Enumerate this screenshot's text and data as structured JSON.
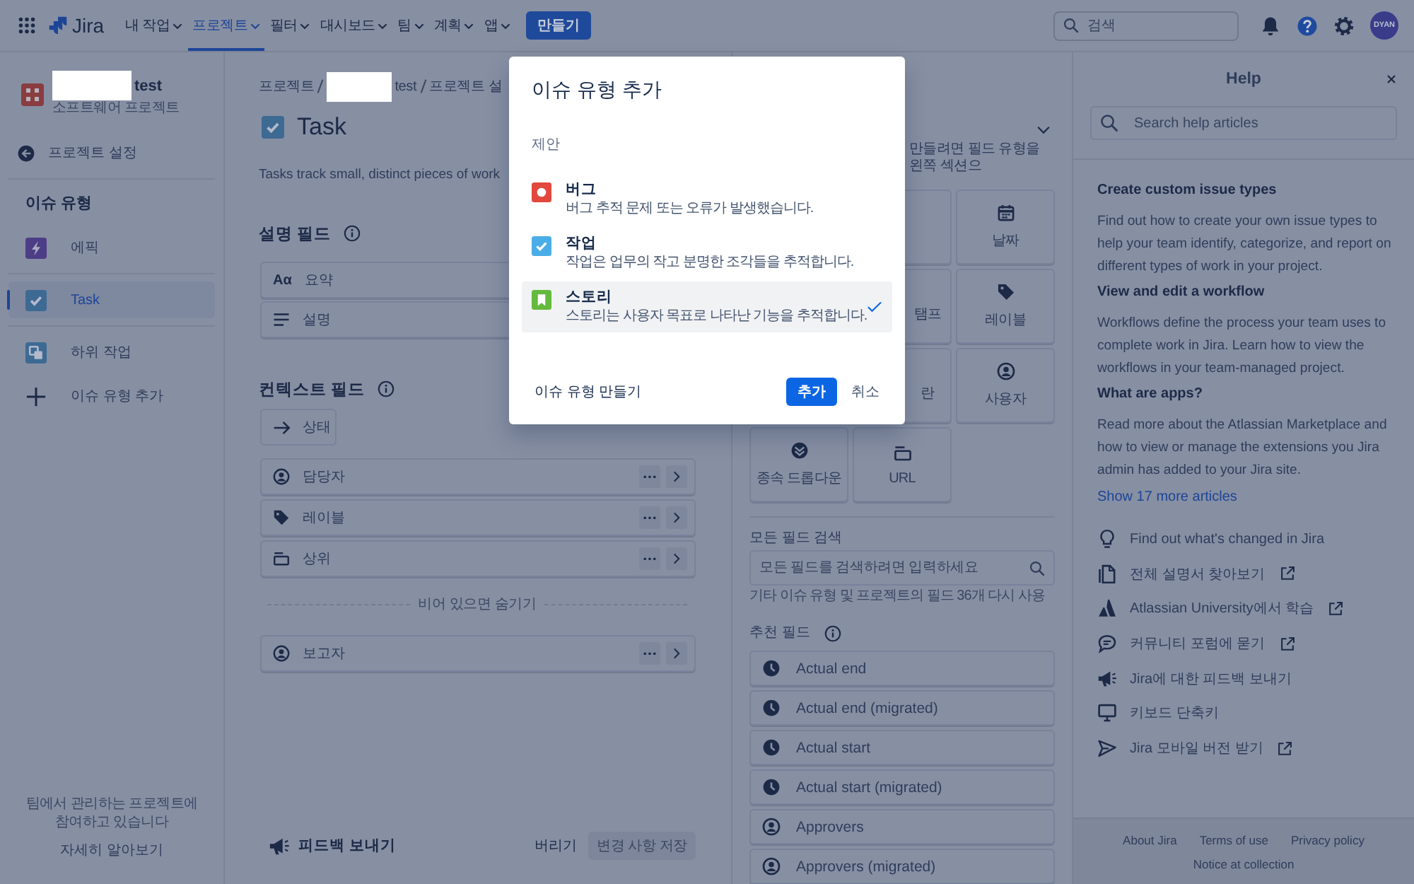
{
  "top_nav": {
    "logo": "Jira",
    "menu": [
      {
        "label": "내 작업",
        "selected": false
      },
      {
        "label": "프로젝트",
        "selected": true
      },
      {
        "label": "필터",
        "selected": false
      },
      {
        "label": "대시보드",
        "selected": false
      },
      {
        "label": "팀",
        "selected": false
      },
      {
        "label": "계획",
        "selected": false
      },
      {
        "label": "앱",
        "selected": false
      }
    ],
    "create_button": "만들기",
    "search": {
      "placeholder": "검색"
    },
    "icons": [
      {
        "kind": "notifications",
        "selected": false
      },
      {
        "kind": "help",
        "selected": true
      },
      {
        "kind": "settings",
        "selected": false
      }
    ],
    "avatar": "DYAN"
  },
  "sidebar": {
    "project": {
      "name": "test",
      "type": "소프트웨어 프로젝트"
    },
    "back_link": "프로젝트 설정",
    "section_title": "이슈 유형",
    "groups": [
      {
        "items": [
          {
            "label": "에픽",
            "kind": "epic",
            "selected": false
          }
        ]
      },
      {
        "items": [
          {
            "label": "Task",
            "kind": "task",
            "selected": true
          }
        ]
      },
      {
        "items": [
          {
            "label": "하위 작업",
            "kind": "subtask",
            "selected": false
          },
          {
            "label": "이슈 유형 추가",
            "kind": "add",
            "selected": false
          }
        ]
      }
    ],
    "footer": {
      "text": "팀에서 관리하는 프로젝트에 참여하고 있습니다",
      "link": "자세히 알아보기"
    }
  },
  "main": {
    "breadcrumbs": [
      "프로젝트",
      "test",
      "프로젝트 설"
    ],
    "title": "Task",
    "description": "Tasks track small, distinct pieces of work",
    "description_fields": {
      "title": "설명 필드",
      "fields": [
        {
          "label": "요약",
          "kind": "summary",
          "glyph": "Aα"
        },
        {
          "label": "설명",
          "kind": "description"
        }
      ]
    },
    "context_fields": {
      "title": "컨텍스트 필드",
      "status": "상태",
      "fields": [
        {
          "label": "담당자",
          "kind": "user"
        },
        {
          "label": "레이블",
          "kind": "label"
        },
        {
          "label": "상위",
          "kind": "parent"
        }
      ],
      "hide_when_empty": "비어 있으면 숨기기",
      "hidden_fields": [
        {
          "label": "보고자",
          "kind": "user"
        }
      ]
    },
    "footer": {
      "feedback": "피드백 보내기",
      "discard": "버리기",
      "save": {
        "label": "변경 사항 저장",
        "disabled": true
      }
    }
  },
  "field_palette": {
    "description": "만들려면 필드 유형을 왼쪽 섹션으",
    "tile_rows": [
      [
        {
          "kind": "cut"
        },
        {
          "kind": "date",
          "label": "날짜"
        }
      ],
      [
        {
          "kind": "cut",
          "label": "탬프"
        },
        {
          "kind": "label",
          "label": "레이블"
        }
      ],
      [
        {
          "kind": "cut",
          "label": "란"
        },
        {
          "kind": "user",
          "label": "사용자"
        }
      ],
      [
        {
          "kind": "dropdown",
          "label": "종속 드롭다운"
        },
        {
          "kind": "url",
          "label": "URL"
        }
      ]
    ],
    "search": {
      "label": "모든 필드 검색",
      "placeholder": "모든 필드를 검색하려면 입력하세요",
      "helper": "기타 이슈 유형 및 프로젝트의 필드 36개 다시 사용"
    },
    "suggested": {
      "title": "추천 필드",
      "fields": [
        {
          "label": "Actual end",
          "kind": "clock"
        },
        {
          "label": "Actual end (migrated)",
          "kind": "clock"
        },
        {
          "label": "Actual start",
          "kind": "clock"
        },
        {
          "label": "Actual start (migrated)",
          "kind": "clock"
        },
        {
          "label": "Approvers",
          "kind": "user"
        },
        {
          "label": "Approvers (migrated)",
          "kind": "user"
        }
      ]
    }
  },
  "help_panel": {
    "title": "Help",
    "search": {
      "placeholder": "Search help articles"
    },
    "articles": [
      {
        "title": "Create custom issue types",
        "summary": "Find out how to create your own issue types to help your team identify, categorize, and report on different types of work in your project."
      },
      {
        "title": "View and edit a workflow",
        "summary": "Workflows define the process your team uses to complete work in Jira. Learn how to view the workflows in your team-managed project."
      },
      {
        "title": "What are apps?",
        "summary": "Read more about the Atlassian Marketplace and how to view or manage the extensions you Jira admin has added to your Jira site."
      }
    ],
    "more_link": "Show 17 more articles",
    "links": [
      {
        "label": "Find out what's changed in Jira",
        "kind": "bulb",
        "external": false
      },
      {
        "label": "전체 설명서 찾아보기",
        "kind": "document",
        "external": true
      },
      {
        "label": "Atlassian University에서 학습",
        "kind": "university",
        "external": true
      },
      {
        "label": "커뮤니티 포럼에 묻기",
        "kind": "community",
        "external": true
      },
      {
        "label": "Jira에 대한 피드백 보내기",
        "kind": "feedback",
        "external": false
      },
      {
        "label": "키보드 단축키",
        "kind": "keyboard",
        "external": false
      },
      {
        "label": "Jira 모바일 버전 받기",
        "kind": "mobile",
        "external": true
      }
    ],
    "footer_links": [
      "About Jira",
      "Terms of use",
      "Privacy policy",
      "Notice at collection"
    ]
  },
  "dialog": {
    "title": "이슈 유형 추가",
    "section": "제안",
    "options": [
      {
        "kind": "bug",
        "name": "버그",
        "description": "버그 추적 문제 또는 오류가 발생했습니다.",
        "selected": false
      },
      {
        "kind": "task",
        "name": "작업",
        "description": "작업은 업무의 작고 분명한 조각들을 추적합니다.",
        "selected": false
      },
      {
        "kind": "story",
        "name": "스토리",
        "description": "스토리는 사용자 목표로 나타난 기능을 추적합니다.",
        "selected": true
      }
    ],
    "create_link": "이슈 유형 만들기",
    "primary_button": "추가",
    "secondary_button": "취소"
  }
}
